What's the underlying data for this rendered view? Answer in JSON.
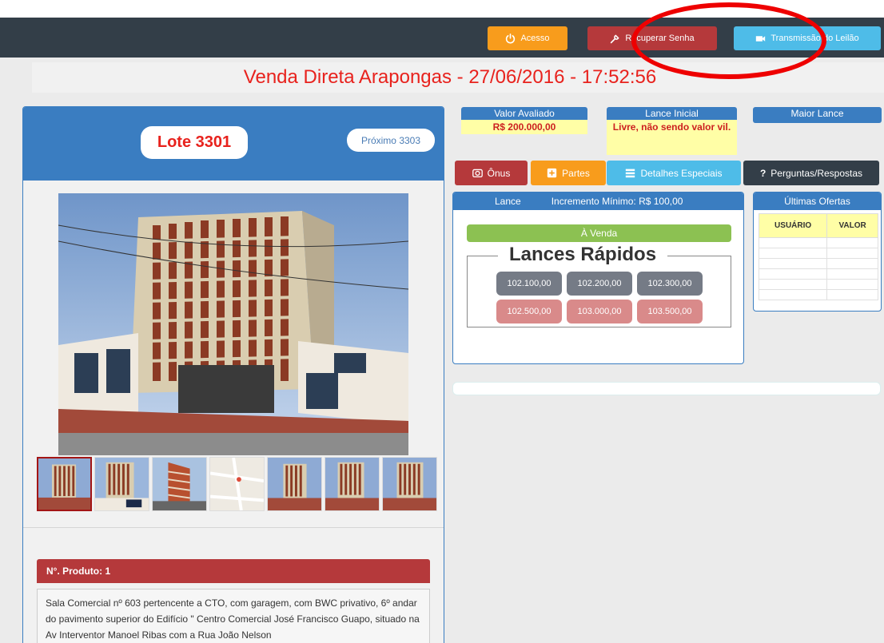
{
  "header": {
    "acesso_label": "Acesso",
    "recuperar_label": "Recuperar Senha",
    "transmissao_label": "Transmissão do Leilão",
    "colors": {
      "acesso": "#f89c1c",
      "recuperar": "#b5393b",
      "transmissao": "#4ebce8",
      "bar": "#333e48"
    }
  },
  "page_title": "Venda Direta Arapongas - 27/06/2016 - 17:52:56",
  "lote": {
    "label": "Lote 3301",
    "proximo_label": "Próximo 3303"
  },
  "info": {
    "valor_avaliado_label": "Valor Avaliado",
    "valor_avaliado_value": "R$ 200.000,00",
    "lance_inicial_label": "Lance Inicial",
    "lance_inicial_value": "Livre, não sendo valor vil.",
    "maior_lance_label": "Maior Lance"
  },
  "tabs": {
    "onus": "Ônus",
    "partes": "Partes",
    "detalhes": "Detalhes Especiais",
    "perguntas": "Perguntas/Respostas"
  },
  "lance": {
    "lance_label": "Lance",
    "incremento_label": "Incremento Mínimo: R$  100,00",
    "status": "À Venda",
    "rapidos_title": "Lances Rápidos",
    "quick_bids": [
      "102.100,00",
      "102.200,00",
      "102.300,00",
      "102.500,00",
      "103.000,00",
      "103.500,00"
    ]
  },
  "ofertas": {
    "title": "Últimas Ofertas",
    "col_usuario": "USUÁRIO",
    "col_valor": "VALOR"
  },
  "produto": {
    "header": "N°. Produto: 1",
    "description": "Sala Comercial nº 603 pertencente a CTO, com garagem, com BWC privativo, 6º andar do pavimento superior do Edifício \" Centro Comercial José Francisco Guapo, situado na Av Interventor Manoel Ribas com a Rua João Nelson"
  }
}
